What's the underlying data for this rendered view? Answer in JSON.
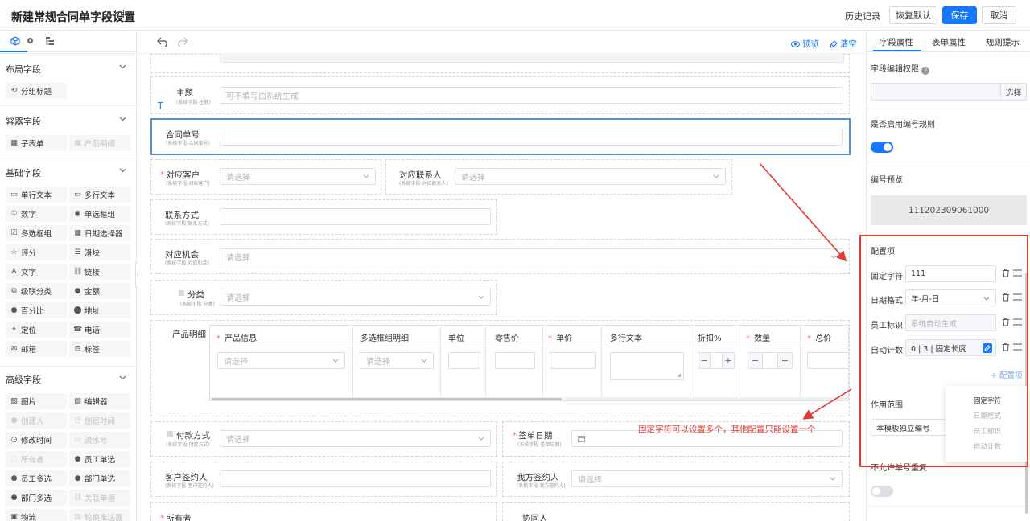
{
  "header": {
    "title": "新建常规合同单字段设置",
    "history": "历史记录",
    "restore_default": "恢复默认",
    "save": "保存",
    "cancel": "取消"
  },
  "palette": {
    "sections": {
      "layout": "布局字段",
      "container": "容器字段",
      "basic": "基础字段",
      "advanced": "高级字段"
    },
    "layout_items": [
      "分组标题"
    ],
    "container_items": [
      "子表单",
      "产品明细"
    ],
    "basic_items": [
      "单行文本",
      "多行文本",
      "数字",
      "单选框组",
      "多选框组",
      "日期选择器",
      "评分",
      "滑块",
      "文字",
      "链接",
      "级联分类",
      "金额",
      "百分比",
      "地址",
      "定位",
      "电话",
      "邮箱",
      "标签"
    ],
    "advanced_items": [
      "图片",
      "编辑器",
      "创建人",
      "创建时间",
      "修改时间",
      "流水号",
      "所有者",
      "员工单选",
      "员工多选",
      "部门单选",
      "部门多选",
      "关联单据",
      "物流",
      "轮换推送器"
    ]
  },
  "toolbar": {
    "preview": "预览",
    "clear": "清空"
  },
  "form": {
    "subject": {
      "label": "主题",
      "sub": "(系统字段-主题)",
      "placeholder": "可不填写由系统生成"
    },
    "contract_no": {
      "label": "合同单号",
      "sub": "(系统字段-合同单号)"
    },
    "customer": {
      "label": "对应客户",
      "sub": "(系统字段-对应客户)",
      "placeholder": "请选择"
    },
    "contact": {
      "label": "对应联系人",
      "sub": "(系统字段-对应联系人)",
      "placeholder": "请选择"
    },
    "contact_way": {
      "label": "联系方式",
      "sub": "(系统字段-联系方式)"
    },
    "opportunity": {
      "label": "对应机会",
      "sub": "(系统字段-对应机会)",
      "placeholder": "请选择"
    },
    "category": {
      "label": "分类",
      "sub": "(系统字段-分类)",
      "placeholder": "请选择"
    },
    "product": {
      "label": "产品明细",
      "columns": [
        "产品信息",
        "多选框组明细",
        "单位",
        "零售价",
        "单价",
        "多行文本",
        "折扣%",
        "数量",
        "总价"
      ],
      "select_placeholder": "请选择"
    },
    "payment": {
      "label": "付款方式",
      "sub": "(系统字段-付款方式)",
      "placeholder": "请选择"
    },
    "sign_date": {
      "label": "签单日期",
      "sub": "(系统字段-签单日期)"
    },
    "customer_signer": {
      "label": "客户签约人",
      "sub": "(系统字段-客户签约人)"
    },
    "our_signer": {
      "label": "我方签约人",
      "sub": "(系统字段-我方签约人)",
      "placeholder": "请选择"
    },
    "owner": {
      "label": "所有者"
    },
    "collaborator": {
      "label": "协同人"
    }
  },
  "annotation": "固定字符可以设置多个，其他配置只能设置一个",
  "right_panel": {
    "tabs": [
      "字段属性",
      "表单属性",
      "规则提示"
    ],
    "edit_permission": "字段编辑权限",
    "choose": "选择",
    "enable_numbering": "是否启用编号规则",
    "number_preview": "编号预览",
    "preview_value": "111202309061000",
    "config_title": "配置项",
    "config_rows": [
      {
        "label": "固定字符",
        "value": "111"
      },
      {
        "label": "日期格式",
        "value": "年-月-日"
      },
      {
        "label": "员工标识",
        "value": "系统自动生成"
      },
      {
        "label": "自动计数",
        "value": "0 | 3 | 固定长度"
      }
    ],
    "add_config": "+ 配置项",
    "scope_label": "作用范围",
    "scope_value": "本模板独立编号",
    "no_repeat": "不允许单号重复",
    "menu": [
      "固定字符",
      "日期格式",
      "员工标识",
      "自动计数"
    ]
  },
  "colors": {
    "primary": "#1677ff",
    "annotation_red": "#e53935",
    "selected_border": "#4e8fd8"
  }
}
